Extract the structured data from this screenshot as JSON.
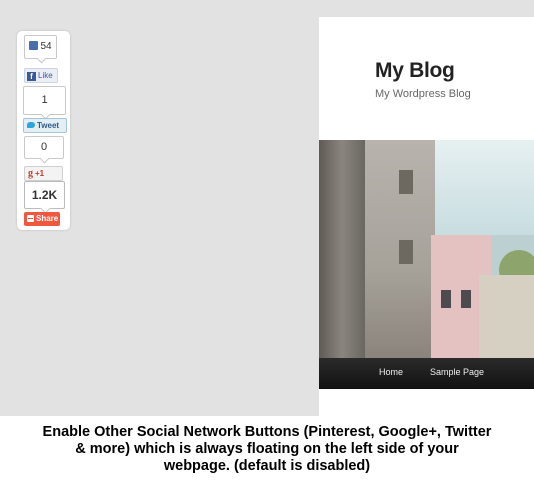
{
  "share_bar": {
    "facebook": {
      "count": "54",
      "button_label": "Like",
      "logo": "f"
    },
    "twitter": {
      "count": "1",
      "button_label": "Tweet"
    },
    "google_plus": {
      "count": "0",
      "button_label": "+1",
      "logo": "g"
    },
    "total": {
      "count": "1.2K",
      "button_label": "Share"
    }
  },
  "blog": {
    "title": "My Blog",
    "tagline": "My Wordpress Blog",
    "nav": [
      {
        "label": "Home"
      },
      {
        "label": "Sample Page"
      }
    ]
  },
  "caption": {
    "lines": [
      "Enable Other Social Network Buttons (Pinterest, Google+, Twitter",
      "& more) which is always floating on the left side of your",
      "webpage. (default is disabled)"
    ]
  },
  "colors": {
    "background": "#e2e2e2",
    "facebook": "#3b5998",
    "twitter": "#2ea3dc",
    "google_plus": "#c13a2b",
    "share": "#f0573f",
    "nav_bar": "#1a1a1a"
  },
  "icons": [
    "thumbs-up-icon",
    "facebook-icon",
    "twitter-bird-icon",
    "google-plus-icon",
    "share-icon"
  ]
}
